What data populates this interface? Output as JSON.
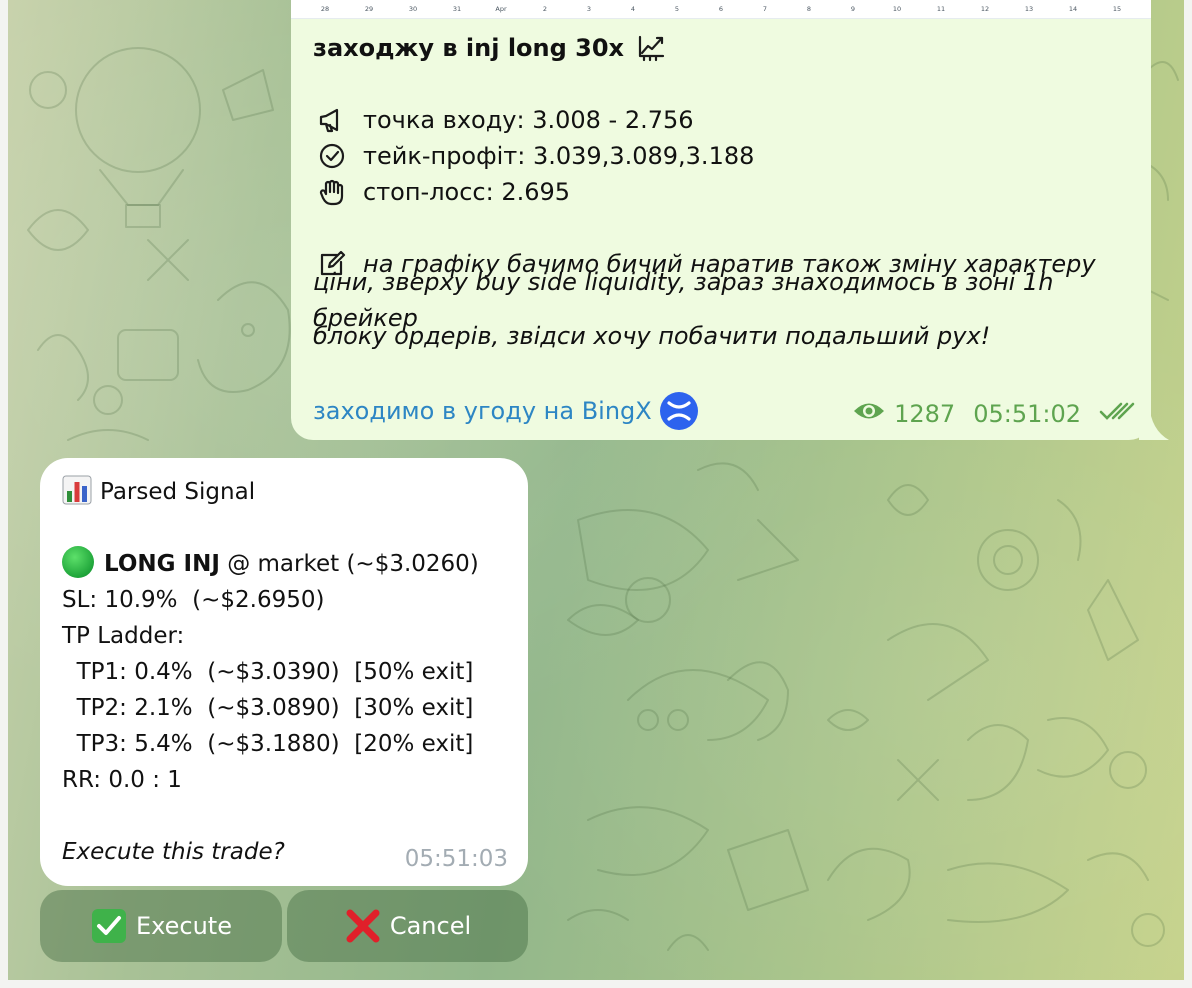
{
  "colors": {
    "post_bubble": "#effbe0",
    "bot_bubble": "#ffffff",
    "link": "#2d86c4",
    "meta_green": "#5ea44f",
    "time_gray": "#a3acb3"
  },
  "post": {
    "chart_axis_ticks": [
      "28",
      "29",
      "30",
      "31",
      "Apr",
      "2",
      "3",
      "4",
      "5",
      "6",
      "7",
      "8",
      "9",
      "10",
      "11",
      "12",
      "13",
      "14",
      "15"
    ],
    "title": "заходжу в inj long 30x",
    "title_icon": "chart-increasing-icon",
    "entry": {
      "icon": "megaphone-icon",
      "text": "точка входу: 3.008 - 2.756"
    },
    "take_profit": {
      "icon": "check-circle-icon",
      "text": "тейк-профіт: 3.039,3.089,3.188"
    },
    "stop_loss": {
      "icon": "raised-hand-icon",
      "text": "стоп-лосс: 2.695"
    },
    "analysis": {
      "icon": "note-edit-icon",
      "line1": "на графіку бачимо бичий наратив також зміну характеру",
      "line2": "ціни, зверху buy side liquidity, зараз знаходимось в зоні 1h брейкер",
      "line3": "блоку ордерів, звідси хочу побачити подальший рух!"
    },
    "link_text": "заходимо в угоду на BingX",
    "views": "1287",
    "time": "05:51:02"
  },
  "bot": {
    "header": "Parsed Signal",
    "signal_side": "LONG INJ",
    "signal_rest": " @ market (~$3.0260)",
    "sl": "SL: 10.9%  (~$2.6950)",
    "tp_header": "TP Ladder:",
    "tp1": "  TP1: 0.4%  (~$3.0390)  [50% exit]",
    "tp2": "  TP2: 2.1%  (~$3.0890)  [30% exit]",
    "tp3": "  TP3: 5.4%  (~$3.1880)  [20% exit]",
    "rr": "RR: 0.0 : 1",
    "question": "Execute this trade?",
    "time": "05:51:03"
  },
  "keyboard": {
    "execute": "Execute",
    "cancel": "Cancel"
  }
}
